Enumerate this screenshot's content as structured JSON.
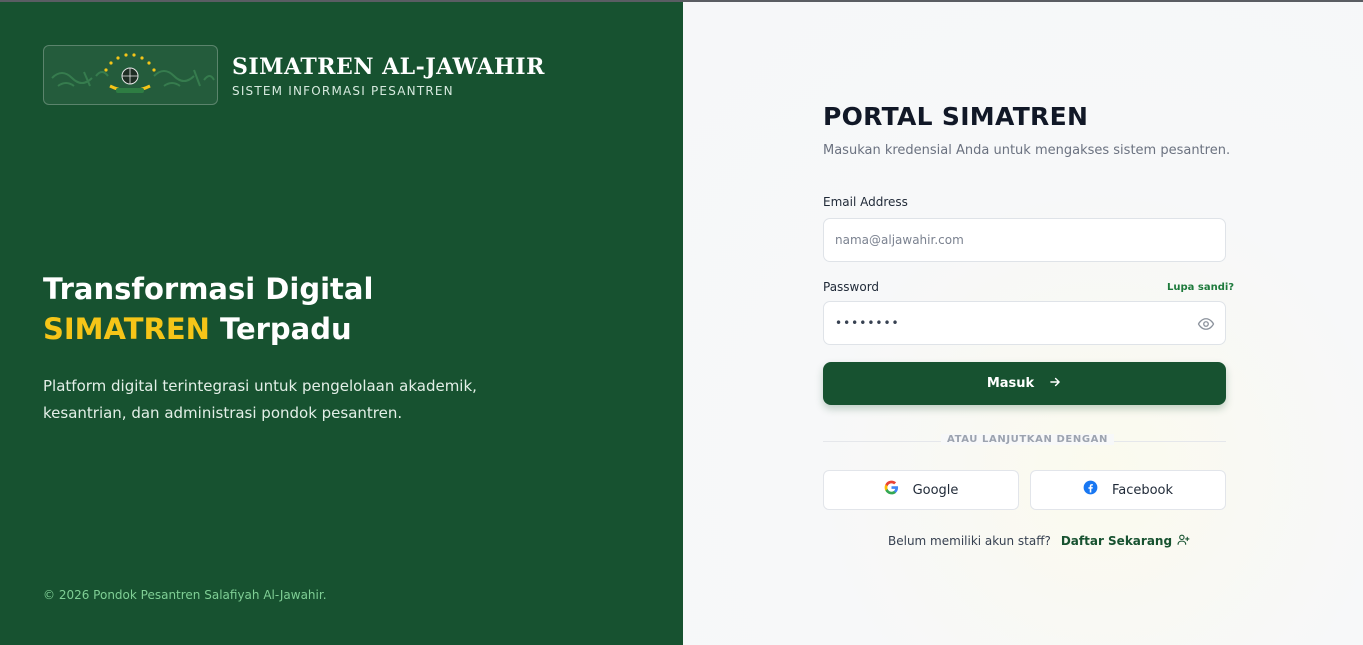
{
  "brand": {
    "title": "SIMATREN AL-JAWAHIR",
    "subtitle": "SISTEM INFORMASI PESANTREN"
  },
  "hero": {
    "line1": "Transformasi Digital",
    "line2_highlight": "SIMATREN",
    "line2_rest": " Terpadu",
    "description": "Platform digital terintegrasi untuk pengelolaan akademik, kesantrian, dan administrasi pondok pesantren.",
    "highlight_color": "#f5c518"
  },
  "footer": {
    "copyright": "© 2026 Pondok Pesantren Salafiyah Al-Jawahir."
  },
  "login": {
    "title": "PORTAL SIMATREN",
    "subtitle": "Masukan kredensial Anda untuk mengakses sistem pesantren.",
    "email_label": "Email Address",
    "email_placeholder": "nama@aljawahir.com",
    "email_value": "",
    "password_label": "Password",
    "password_value": "secret12",
    "forgot_label": "Lupa sandi?",
    "submit_label": "Masuk",
    "divider_label": "ATAU LANJUTKAN DENGAN",
    "google_label": "Google",
    "facebook_label": "Facebook",
    "signup_prompt": "Belum memiliki akun staff?",
    "signup_link": "Daftar Sekarang"
  },
  "icons": {
    "password_toggle": "eye-icon",
    "submit": "arrow-right-icon",
    "google": "google-icon",
    "facebook": "facebook-icon",
    "signup": "user-plus-icon"
  },
  "colors": {
    "brand_green": "#175230",
    "accent_yellow": "#f5c518",
    "link_green": "#1e7a3c"
  }
}
